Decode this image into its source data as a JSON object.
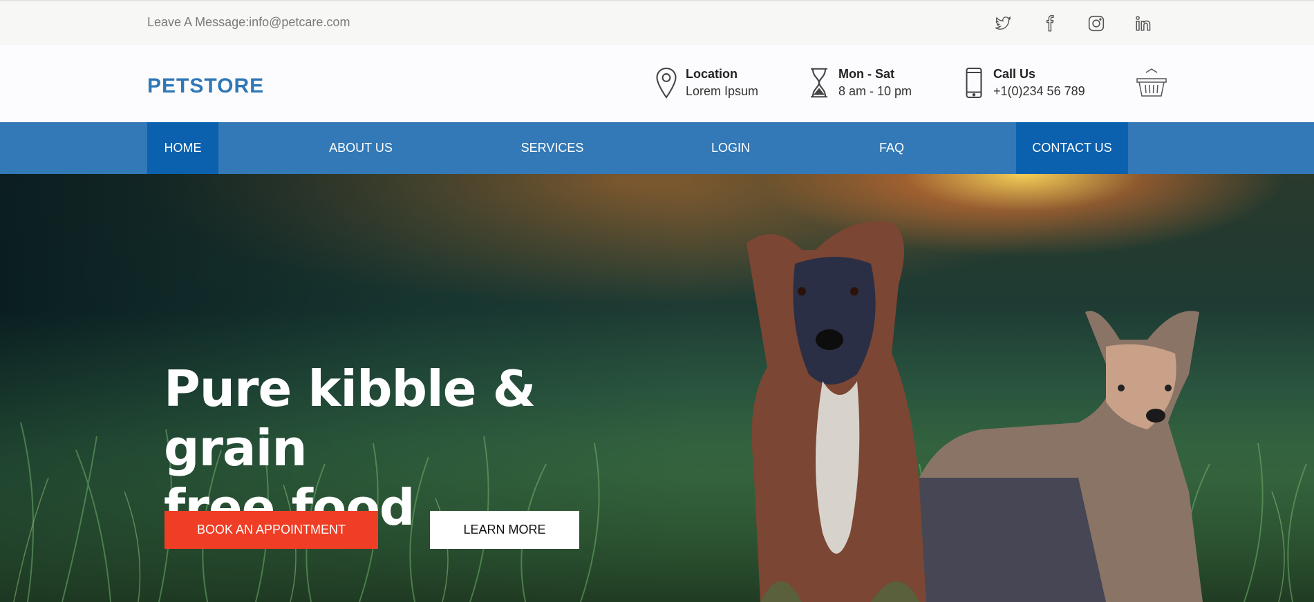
{
  "topbar": {
    "message": "Leave A Message:info@petcare.com",
    "social": [
      {
        "icon": "twitter-icon"
      },
      {
        "icon": "facebook-icon"
      },
      {
        "icon": "instagram-icon"
      },
      {
        "icon": "linkedin-icon"
      }
    ]
  },
  "header": {
    "logo": "PETSTORE",
    "location": {
      "icon": "map-pin-icon",
      "title": "Location",
      "value": "Lorem Ipsum"
    },
    "hours": {
      "icon": "hourglass-icon",
      "title": "Mon - Sat",
      "value": "8 am - 10 pm"
    },
    "call": {
      "icon": "phone-icon",
      "title": "Call Us",
      "value": "+1(0)234 56 789"
    },
    "cart_icon": "basket-icon"
  },
  "nav": {
    "items": [
      {
        "label": "HOME",
        "active": true
      },
      {
        "label": "ABOUT US",
        "active": false
      },
      {
        "label": "SERVICES",
        "active": false
      },
      {
        "label": "LOGIN",
        "active": false
      },
      {
        "label": "FAQ",
        "active": false
      },
      {
        "label": "CONTACT US",
        "active": true
      }
    ]
  },
  "hero": {
    "title_line1": "Pure kibble & grain",
    "title_line2": "free food",
    "book_button": "BOOK AN APPOINTMENT",
    "learn_button": "LEARN MORE"
  },
  "colors": {
    "brand_blue": "#3379b7",
    "nav_active": "#0b61ad",
    "cta_red": "#ef3e25"
  }
}
